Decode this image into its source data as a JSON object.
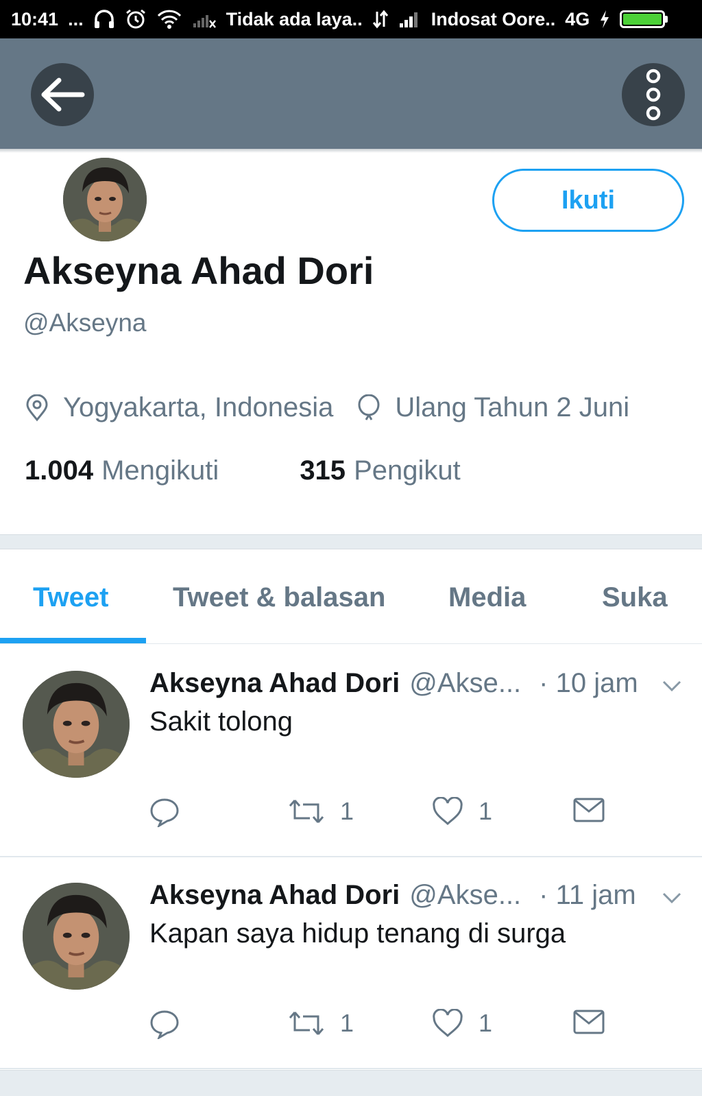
{
  "status_bar": {
    "time": "10:41",
    "dots": "...",
    "wifi_text": "Tidak ada laya..",
    "carrier": "Indosat Oore..",
    "network": "4G",
    "battery_level": 1.0
  },
  "header": {
    "back_icon": "arrow-left-icon",
    "more_icon": "more-vertical-icon"
  },
  "profile": {
    "follow_label": "Ikuti",
    "name": "Akseyna Ahad Dori",
    "handle": "@Akseyna",
    "location": "Yogyakarta, Indonesia",
    "birthday": "Ulang Tahun 2 Juni",
    "following_count": "1.004",
    "following_label": "Mengikuti",
    "followers_count": "315",
    "followers_label": "Pengikut"
  },
  "tabs": [
    {
      "label": "Tweet",
      "active": true
    },
    {
      "label": "Tweet & balasan",
      "active": false
    },
    {
      "label": "Media",
      "active": false
    },
    {
      "label": "Suka",
      "active": false
    }
  ],
  "tweets": [
    {
      "name": "Akseyna Ahad Dori",
      "handle": "@Akse...",
      "time": "· 10 jam",
      "text": "Sakit tolong",
      "retweets": "1",
      "likes": "1"
    },
    {
      "name": "Akseyna Ahad Dori",
      "handle": "@Akse...",
      "time": "· 11 jam",
      "text": "Kapan saya hidup tenang di surga",
      "retweets": "1",
      "likes": "1"
    }
  ],
  "colors": {
    "accent": "#1da1f2",
    "header_bg": "#657786",
    "text_primary": "#14171a",
    "text_secondary": "#657786"
  }
}
